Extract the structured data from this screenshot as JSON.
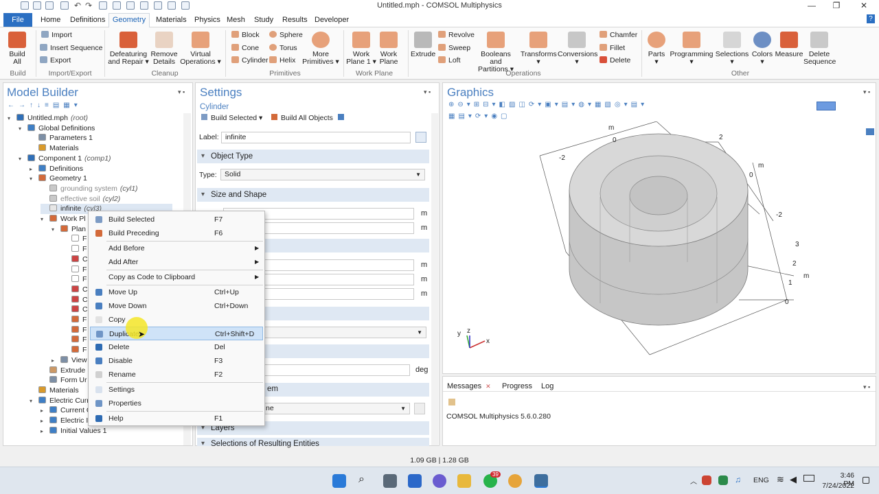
{
  "window": {
    "title": "Untitled.mph - COMSOL Multiphysics"
  },
  "menubar": {
    "file": "File",
    "items": [
      "Home",
      "Definitions",
      "Geometry",
      "Materials",
      "Physics",
      "Mesh",
      "Study",
      "Results",
      "Developer"
    ],
    "help": "?"
  },
  "ribbon": {
    "build": {
      "label1": "Build",
      "label2": "All",
      "group": "Build"
    },
    "import_export": {
      "items": [
        "Import",
        "Insert Sequence",
        "Export"
      ],
      "group": "Import/Export"
    },
    "cleanup": {
      "items": [
        [
          "Defeaturing",
          "and Repair ▾"
        ],
        [
          "Remove",
          "Details"
        ],
        [
          "Virtual",
          "Operations ▾"
        ]
      ],
      "group": "Cleanup"
    },
    "primitives": {
      "col1": [
        "Block",
        "Cone",
        "Cylinder"
      ],
      "col2": [
        "Sphere",
        "Torus",
        "Helix"
      ],
      "more": [
        "More",
        "Primitives ▾"
      ],
      "group": "Primitives"
    },
    "workplane": {
      "items": [
        [
          "Work",
          "Plane 1 ▾"
        ],
        [
          "Work",
          "Plane"
        ]
      ],
      "group": "Work Plane"
    },
    "operations": {
      "extrude": "Extrude",
      "small": [
        "Revolve",
        "Sweep",
        "Loft"
      ],
      "big": [
        [
          "Booleans and",
          "Partitions ▾"
        ],
        [
          "Transforms",
          "▾"
        ],
        [
          "Conversions",
          "▾"
        ]
      ],
      "small2": [
        "Chamfer",
        "Fillet",
        "Delete"
      ],
      "group": "Operations"
    },
    "other": {
      "items": [
        [
          "Parts",
          "▾"
        ],
        [
          "Programming",
          "▾"
        ],
        [
          "Selections",
          "▾"
        ],
        [
          "Colors",
          "▾"
        ],
        [
          "Measure",
          ""
        ],
        [
          "Delete",
          "Sequence"
        ]
      ],
      "group": "Other"
    }
  },
  "model_builder": {
    "title": "Model Builder",
    "tree": [
      {
        "text": "Untitled.mph",
        "suffix": "(root)",
        "level": 0,
        "exp": "▾",
        "color": "#2f6fb8"
      },
      {
        "text": "Global Definitions",
        "level": 1,
        "exp": "▾",
        "color": "#3f7fc5"
      },
      {
        "text": "Parameters 1",
        "level": 2,
        "color": "#7d8fa5"
      },
      {
        "text": "Materials",
        "level": 2,
        "color": "#d99a2b"
      },
      {
        "text": "Component 1",
        "suffix": "(comp1)",
        "level": 1,
        "exp": "▾",
        "color": "#2f6fb8"
      },
      {
        "text": "Definitions",
        "level": 2,
        "exp": "▸",
        "color": "#3f7fc5"
      },
      {
        "text": "Geometry 1",
        "level": 2,
        "exp": "▾",
        "color": "#d36a3a"
      },
      {
        "text": "grounding system",
        "suffix": "(cyl1)",
        "level": 3,
        "grey": true,
        "color": "#c9c9c9"
      },
      {
        "text": "effective soil",
        "suffix": "(cyl2)",
        "level": 3,
        "grey": true,
        "color": "#c9c9c9"
      },
      {
        "text": "infinite",
        "suffix": "(cyl3)",
        "level": 3,
        "color": "#e6e6e6",
        "selected": true
      },
      {
        "text": "Work Pl",
        "level": 3,
        "exp": "▾",
        "color": "#d36a3a"
      },
      {
        "text": "Plan",
        "level": 4,
        "exp": "▾",
        "color": "#d36a3a"
      },
      {
        "text": "F",
        "level": 5,
        "color": "#ffffff"
      },
      {
        "text": "F",
        "level": 5,
        "color": "#ffffff"
      },
      {
        "text": "C",
        "level": 5,
        "color": "#c44"
      },
      {
        "text": "F",
        "level": 5,
        "color": "#ffffff"
      },
      {
        "text": "F",
        "level": 5,
        "color": "#ffffff"
      },
      {
        "text": "C",
        "level": 5,
        "color": "#c44"
      },
      {
        "text": "C",
        "level": 5,
        "color": "#c44"
      },
      {
        "text": "C",
        "level": 5,
        "color": "#c44"
      },
      {
        "text": "F",
        "level": 5,
        "color": "#d36a3a"
      },
      {
        "text": "F",
        "level": 5,
        "color": "#d36a3a"
      },
      {
        "text": "F",
        "level": 5,
        "color": "#d36a3a"
      },
      {
        "text": "F",
        "level": 5,
        "color": "#d36a3a"
      },
      {
        "text": "View",
        "level": 4,
        "exp": "▸",
        "color": "#7d8fa5"
      },
      {
        "text": "Extrude",
        "level": 3,
        "color": "#c96"
      },
      {
        "text": "Form Ur",
        "level": 3,
        "color": "#7d8fa5"
      },
      {
        "text": "Materials",
        "level": 2,
        "color": "#d99a2b"
      },
      {
        "text": "Electric Curr",
        "level": 2,
        "exp": "▾",
        "color": "#3f7fc5"
      },
      {
        "text": "Current C",
        "level": 3,
        "exp": "▸",
        "color": "#3f7fc5"
      },
      {
        "text": "Electric Insulation 1",
        "level": 3,
        "exp": "▸",
        "color": "#3f7fc5"
      },
      {
        "text": "Initial Values 1",
        "level": 3,
        "exp": "▸",
        "color": "#3f7fc5"
      }
    ]
  },
  "settings": {
    "title": "Settings",
    "subtitle": "Cylinder",
    "build_selected": "Build Selected ▾",
    "build_all": "Build All Objects",
    "label_caption": "Label:",
    "label_value": "infinite",
    "sections": [
      "Object Type",
      "Size and Shape",
      "Layers",
      "Selections of Resulting Entities"
    ],
    "type_caption": "Type:",
    "type_value": "Solid",
    "unit_m": "m",
    "unit_deg": "deg",
    "partial_em": "em",
    "partial_ne": "ne"
  },
  "graphics": {
    "title": "Graphics",
    "axes": {
      "m": "m",
      "x": "x",
      "y": "y",
      "z": "z"
    },
    "ticks": {
      "n2a": "-2",
      "zero_top": "0",
      "two": "2",
      "zero_right": "0",
      "n2b": "-2",
      "three": "3",
      "two_b": "2",
      "one": "1",
      "zero_b": "0"
    }
  },
  "messages": {
    "tabs": [
      "Messages",
      "Progress",
      "Log"
    ],
    "text": "COMSOL Multiphysics 5.6.0.280"
  },
  "status": {
    "memory": "1.09 GB | 1.28 GB"
  },
  "taskbar": {
    "lang": "ENG",
    "time": "3:46 PM",
    "date": "7/24/2022",
    "whatsapp_badge": "39"
  },
  "context_menu": {
    "items": [
      {
        "label": "Build Selected",
        "shortcut": "F7",
        "icon": "#7d9bc4"
      },
      {
        "label": "Build Preceding",
        "shortcut": "F6",
        "icon": "#d36a3a"
      },
      {
        "sep": true
      },
      {
        "label": "Add Before",
        "arrow": "▶"
      },
      {
        "label": "Add After",
        "arrow": "▶"
      },
      {
        "sep": true
      },
      {
        "label": "Copy as Code to Clipboard",
        "arrow": "▶"
      },
      {
        "sep": true
      },
      {
        "label": "Move Up",
        "shortcut": "Ctrl+Up",
        "icon": "#4a7fc0"
      },
      {
        "label": "Move Down",
        "shortcut": "Ctrl+Down",
        "icon": "#4a7fc0"
      },
      {
        "label": "Copy",
        "icon": "#e2e2e2"
      },
      {
        "label": "Duplicate",
        "shortcut": "Ctrl+Shift+D",
        "icon": "#6f95c6",
        "highlight": true
      },
      {
        "label": "Delete",
        "shortcut": "Del",
        "icon": "#2e6bb3"
      },
      {
        "label": "Disable",
        "shortcut": "F3",
        "icon": "#4a7fc0"
      },
      {
        "label": "Rename",
        "shortcut": "F2",
        "icon": "#d0d0d0"
      },
      {
        "sep": true
      },
      {
        "label": "Settings",
        "icon": "#d9e2ee"
      },
      {
        "label": "Properties",
        "icon": "#6f95c6"
      },
      {
        "sep": true
      },
      {
        "label": "Help",
        "shortcut": "F1",
        "icon": "#2e6bb3"
      }
    ]
  }
}
